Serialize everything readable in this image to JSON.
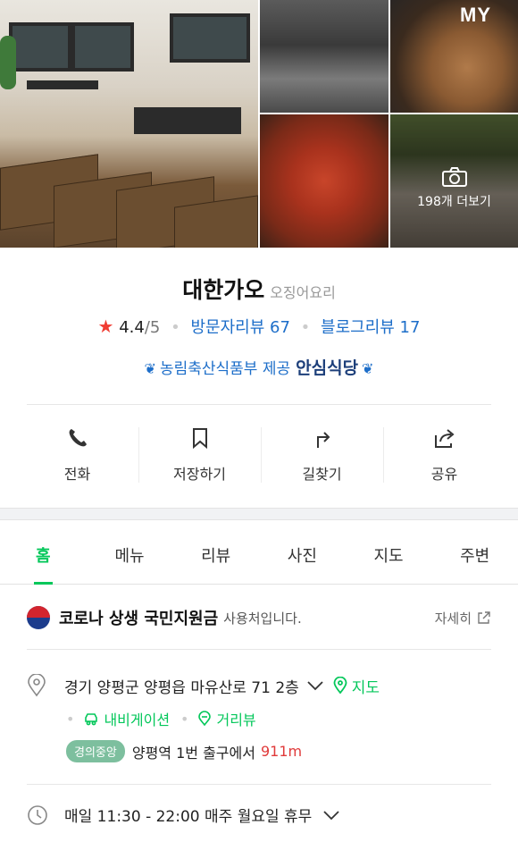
{
  "header": {
    "my_label": "MY"
  },
  "photos": {
    "more_label": "198개 더보기"
  },
  "place": {
    "name": "대한가오",
    "category": "오징어요리",
    "rating": "4.4",
    "rating_max": "/5",
    "visitor_reviews": "방문자리뷰 67",
    "blog_reviews": "블로그리뷰 17",
    "badge_text": "농림축산식품부 제공",
    "badge_bold": "안심식당"
  },
  "actions": [
    {
      "label": "전화",
      "icon": "phone-icon"
    },
    {
      "label": "저장하기",
      "icon": "bookmark-icon"
    },
    {
      "label": "길찾기",
      "icon": "directions-icon"
    },
    {
      "label": "공유",
      "icon": "share-icon"
    }
  ],
  "tabs": [
    {
      "label": "홈",
      "active": true
    },
    {
      "label": "메뉴"
    },
    {
      "label": "리뷰"
    },
    {
      "label": "사진"
    },
    {
      "label": "지도"
    },
    {
      "label": "주변"
    }
  ],
  "notice": {
    "main": "코로나 상생 국민지원금",
    "sub": "사용처입니다.",
    "detail": "자세히"
  },
  "info": {
    "address": "경기 양평군 양평읍 마유산로 71 2층",
    "map_link": "지도",
    "navigation": "내비게이션",
    "street_view": "거리뷰",
    "subway_line": "경의중앙",
    "subway_text": "양평역 1번 출구에서",
    "subway_distance": "911m",
    "hours": "매일 11:30 - 22:00 매주 월요일 휴무"
  },
  "colors": {
    "accent_green": "#03c75a",
    "link_blue": "#1d6ec9",
    "star_red": "#f03c32"
  }
}
